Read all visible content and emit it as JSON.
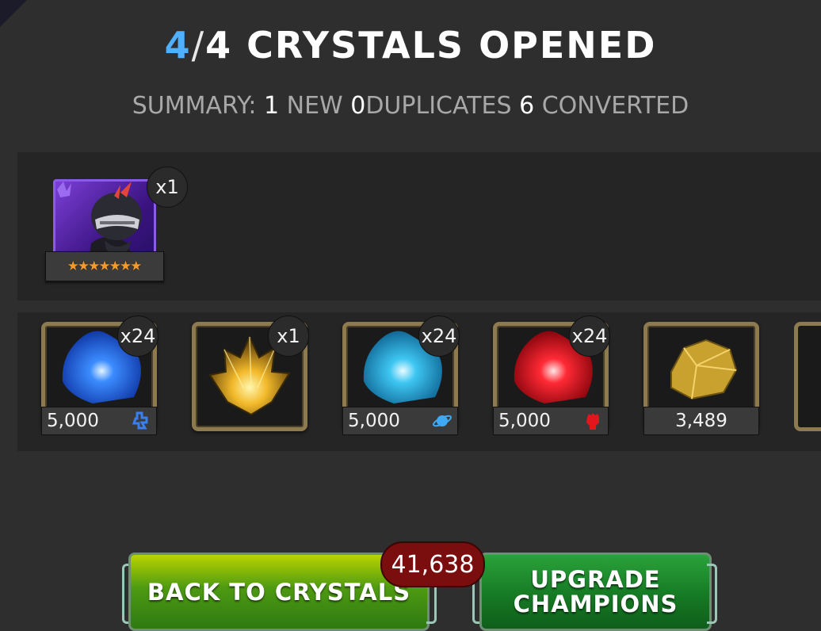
{
  "header": {
    "opened": "4",
    "separator": "/",
    "rest": "4 CRYSTALS OPENED"
  },
  "summary": {
    "label": "SUMMARY:",
    "new_count": "1",
    "new_label": "NEW",
    "dup_count": "0",
    "dup_label": "DUPLICATES",
    "conv_count": "6",
    "conv_label": "CONVERTED"
  },
  "champion": {
    "quantity": "x1",
    "stars": 7,
    "border_color": "#8c5be6"
  },
  "items": [
    {
      "name": "cosmic-shard",
      "quantity": "x24",
      "value": "5,000",
      "icon": "tech-class-icon",
      "color": "#1e5fe0"
    },
    {
      "name": "gold-crystal",
      "quantity": "x1",
      "value": "",
      "icon": "",
      "color": "#e7a41a"
    },
    {
      "name": "cosmic-shard-cyan",
      "quantity": "x24",
      "value": "5,000",
      "icon": "cosmic-class-icon",
      "color": "#1fa3d6"
    },
    {
      "name": "red-shard",
      "quantity": "x24",
      "value": "5,000",
      "icon": "mutant-fist-icon",
      "color": "#e0161e"
    },
    {
      "name": "gold-nugget",
      "quantity": "",
      "value": "3,489",
      "icon": "",
      "color": "#d1a531"
    }
  ],
  "buttons": {
    "back": "BACK TO CRYSTALS",
    "upgrade_line1": "UPGRADE",
    "upgrade_line2": "CHAMPIONS",
    "cost": "41,638"
  }
}
